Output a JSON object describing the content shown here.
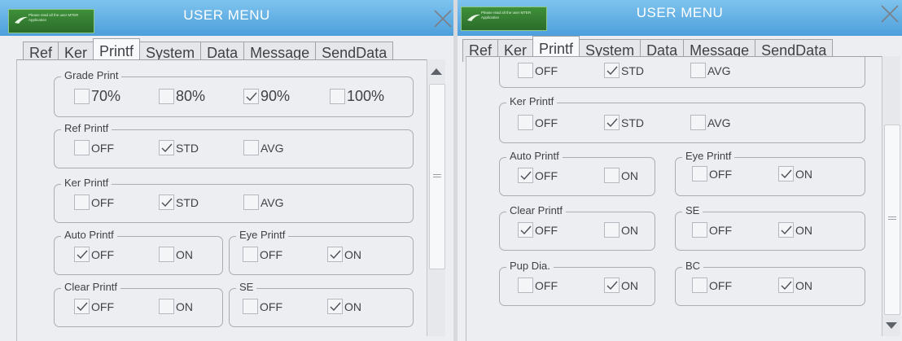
{
  "screens": [
    {
      "logo_text": "Please read all the user MTER Application",
      "title": "USER MENU",
      "tabs": [
        "Ref",
        "Ker",
        "Printf",
        "System",
        "Data",
        "Message",
        "SendData"
      ],
      "active_tab": "Printf",
      "groups": {
        "grade": {
          "label": "Grade Print",
          "options": [
            {
              "label": "70%",
              "checked": false
            },
            {
              "label": "80%",
              "checked": false
            },
            {
              "label": "90%",
              "checked": true
            },
            {
              "label": "100%",
              "checked": false
            }
          ]
        },
        "ref": {
          "label": "Ref Printf",
          "options": [
            {
              "label": "OFF",
              "checked": false
            },
            {
              "label": "STD",
              "checked": true
            },
            {
              "label": "AVG",
              "checked": false
            }
          ]
        },
        "ker": {
          "label": "Ker Printf",
          "options": [
            {
              "label": "OFF",
              "checked": false
            },
            {
              "label": "STD",
              "checked": true
            },
            {
              "label": "AVG",
              "checked": false
            }
          ]
        },
        "auto": {
          "label": "Auto Printf",
          "options": [
            {
              "label": "OFF",
              "checked": true
            },
            {
              "label": "ON",
              "checked": false
            }
          ]
        },
        "eye": {
          "label": "Eye Printf",
          "options": [
            {
              "label": "OFF",
              "checked": false
            },
            {
              "label": "ON",
              "checked": true
            }
          ]
        },
        "clear": {
          "label": "Clear Printf",
          "options": [
            {
              "label": "OFF",
              "checked": true
            },
            {
              "label": "ON",
              "checked": false
            }
          ]
        },
        "se": {
          "label": "SE",
          "options": [
            {
              "label": "OFF",
              "checked": false
            },
            {
              "label": "ON",
              "checked": true
            }
          ]
        }
      },
      "scroll_position": "top"
    },
    {
      "logo_text": "Please read all the user MTER Application",
      "title": "USER MENU",
      "tabs": [
        "Ref",
        "Ker",
        "Printf",
        "System",
        "Data",
        "Message",
        "SendData"
      ],
      "active_tab": "Printf",
      "groups": {
        "ref": {
          "label": "",
          "options": [
            {
              "label": "OFF",
              "checked": false
            },
            {
              "label": "STD",
              "checked": true
            },
            {
              "label": "AVG",
              "checked": false
            }
          ]
        },
        "ker": {
          "label": "Ker Printf",
          "options": [
            {
              "label": "OFF",
              "checked": false
            },
            {
              "label": "STD",
              "checked": true
            },
            {
              "label": "AVG",
              "checked": false
            }
          ]
        },
        "auto": {
          "label": "Auto Printf",
          "options": [
            {
              "label": "OFF",
              "checked": true
            },
            {
              "label": "ON",
              "checked": false
            }
          ]
        },
        "eye": {
          "label": "Eye Printf",
          "options": [
            {
              "label": "OFF",
              "checked": false
            },
            {
              "label": "ON",
              "checked": true
            }
          ]
        },
        "clear": {
          "label": "Clear Printf",
          "options": [
            {
              "label": "OFF",
              "checked": true
            },
            {
              "label": "ON",
              "checked": false
            }
          ]
        },
        "se": {
          "label": "SE",
          "options": [
            {
              "label": "OFF",
              "checked": false
            },
            {
              "label": "ON",
              "checked": true
            }
          ]
        },
        "pup": {
          "label": "Pup Dia.",
          "options": [
            {
              "label": "OFF",
              "checked": false
            },
            {
              "label": "ON",
              "checked": true
            }
          ]
        },
        "bc": {
          "label": "BC",
          "options": [
            {
              "label": "OFF",
              "checked": false
            },
            {
              "label": "ON",
              "checked": true
            }
          ]
        }
      },
      "scroll_position": "bottom"
    }
  ],
  "colors": {
    "titlebar": "#5aa9e0",
    "screen_bg": "#eceef1",
    "border": "#a9adb3",
    "text": "#3f4146",
    "check": "#4a4d53"
  },
  "icons": {
    "close": "close-icon",
    "check": "check-icon",
    "scroll_up": "arrow-up-icon",
    "scroll_down": "arrow-down-icon",
    "logo": "logo-icon"
  }
}
